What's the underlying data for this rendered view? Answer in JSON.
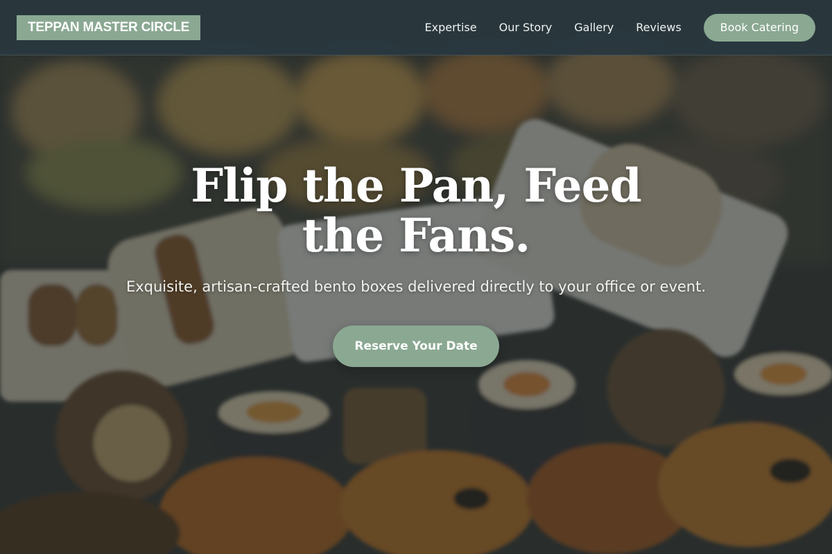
{
  "brand": {
    "name": "TEPPAN MASTER CIRCLE"
  },
  "nav": {
    "links": [
      {
        "label": "Expertise"
      },
      {
        "label": "Our Story"
      },
      {
        "label": "Gallery"
      },
      {
        "label": "Reviews"
      }
    ],
    "cta_label": "Book Catering"
  },
  "hero": {
    "title": "Flip the Pan, Feed the Fans.",
    "subtitle": "Exquisite, artisan-crafted bento boxes delivered directly to your office or event.",
    "cta_label": "Reserve Your Date",
    "background_image": "food-spread-photo"
  },
  "colors": {
    "accent": "#8aa892",
    "nav_background": "#2a3840",
    "text_light": "#ffffff"
  }
}
